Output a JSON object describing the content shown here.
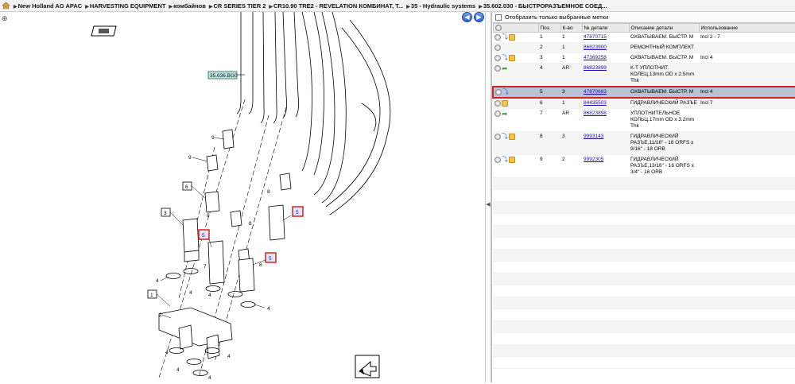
{
  "breadcrumbs": [
    "New Holland AG APAC",
    "HARVESTING EQUIPMENT",
    "комбайнов",
    "CR SERIES TIER 2",
    "CR10.90 TRE2 - REVELATION КОМБИНАТ, Т...",
    "35 - Hydraulic systems",
    "35.602.030 - БЫСТРОРАЗЪЕМНОЕ СОЕД..."
  ],
  "diagram": {
    "ref_label": "35.636.BG0",
    "callouts": [
      "1",
      "2",
      "3",
      "4",
      "5",
      "6",
      "7",
      "8",
      "9"
    ]
  },
  "filter": {
    "label": "Отобразить только выбранные метки"
  },
  "table": {
    "headers": [
      "",
      "Поз.",
      "К-во",
      "№ детали",
      "Описание детали",
      "Использование"
    ],
    "rows": [
      {
        "pos": "1",
        "qty": "1",
        "part": "47870715",
        "desc": "ОХВАТЫВАЕМ. БЫСТР. М",
        "usage": "Incl 2 - 7",
        "icons": [
          "info",
          "swap",
          "box"
        ]
      },
      {
        "pos": "2",
        "qty": "1",
        "part": "86823900",
        "desc": "РЕМОНТНЫЙ КОМПЛЕКТ",
        "usage": "",
        "icons": [
          "info"
        ]
      },
      {
        "pos": "3",
        "qty": "1",
        "part": "47369258",
        "desc": "ОХВАТЫВАЕМ. БЫСТР. М",
        "usage": "Incl 4",
        "icons": [
          "info",
          "swap",
          "box"
        ]
      },
      {
        "pos": "4",
        "qty": "AR",
        "part": "86823899",
        "desc": "К-Т УПЛОТНИТ. КОЛЕЦ,13mm OD x 2.5mm Thk",
        "usage": "",
        "icons": [
          "info",
          "arrow"
        ]
      },
      {
        "pos": "5",
        "qty": "3",
        "part": "47870683",
        "desc": "ОХВАТЫВАЕМ. БЫСТР. М",
        "usage": "Incl 4",
        "icons": [
          "info",
          "swap"
        ]
      },
      {
        "pos": "6",
        "qty": "1",
        "part": "84435503",
        "desc": "ГИДРАВЛИЧЕСКИЙ РАЗЪЕ",
        "usage": "Incl 7",
        "icons": [
          "info",
          "box"
        ]
      },
      {
        "pos": "7",
        "qty": "AR",
        "part": "86823898",
        "desc": "УПЛОТНИТЕЛЬНОЕ КОЛЬЦ,17mm OD x 3.2mm Thk",
        "usage": "",
        "icons": [
          "info",
          "arrow"
        ]
      },
      {
        "pos": "8",
        "qty": "3",
        "part": "9993143",
        "desc": "ГИДРАВЛИЧЕСКИЙ РАЗЪЕ,11/16\" - 16 ORFS x 9/16\" - 18 ORB",
        "usage": "",
        "icons": [
          "info",
          "swap",
          "box"
        ]
      },
      {
        "pos": "9",
        "qty": "2",
        "part": "9992305",
        "desc": "ГИДРАВЛИЧЕСКИЙ РАЗЪЕ,13/16\" - 16 ORFS x 3/4\" - 16 ORB",
        "usage": "",
        "icons": [
          "info",
          "swap",
          "box"
        ]
      }
    ]
  }
}
